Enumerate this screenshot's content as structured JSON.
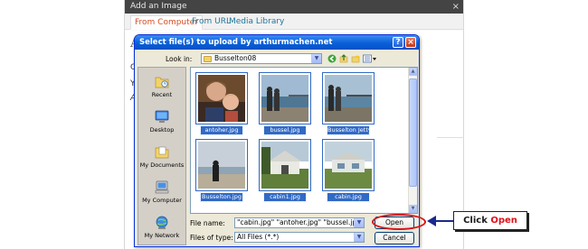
{
  "wp_modal": {
    "title": "Add an Image",
    "close_glyph": "×",
    "tabs": [
      {
        "label": "From Computer",
        "active": true
      },
      {
        "label": "From URL",
        "active": false
      },
      {
        "label": "Media Library",
        "active": false
      }
    ],
    "peek_texts": [
      "A",
      "Cl",
      "Yo",
      "Al"
    ]
  },
  "dialog": {
    "title": "Select file(s) to upload by arthurmachen.net",
    "help_glyph": "?",
    "close_glyph": "×",
    "look_in_label": "Look in:",
    "look_in_value": "Busselton08",
    "toolbar_icons": [
      "back-icon",
      "up-folder-icon",
      "new-folder-icon",
      "views-menu-icon"
    ],
    "places": [
      {
        "label": "Recent",
        "icon": "recent-icon"
      },
      {
        "label": "Desktop",
        "icon": "desktop-icon"
      },
      {
        "label": "My Documents",
        "icon": "my-documents-icon"
      },
      {
        "label": "My Computer",
        "icon": "my-computer-icon"
      },
      {
        "label": "My Network",
        "icon": "my-network-icon"
      }
    ],
    "files": [
      {
        "name": "antoher.jpg",
        "selected": true
      },
      {
        "name": "bussel.jpg",
        "selected": true
      },
      {
        "name": "Busselton Jetty.jpg",
        "selected": true
      },
      {
        "name": "Busselton.jpg",
        "selected": true
      },
      {
        "name": "cabin1.jpg",
        "selected": true
      },
      {
        "name": "cabin.jpg",
        "selected": true
      }
    ],
    "file_name_label": "File name:",
    "file_name_value": "\"cabin.jpg\" \"antoher.jpg\" \"bussel.jpg\" \"Bussel",
    "file_type_label": "Files of type:",
    "file_type_value": "All Files (*.*)",
    "open_label": "Open",
    "cancel_label": "Cancel"
  },
  "annotation": {
    "prefix": "Click ",
    "highlight": "Open",
    "ring_color": "#d7141a",
    "arrow_color": "#1a2a8c"
  },
  "colors": {
    "xp_title_blue": "#0a5fd8",
    "selection_blue": "#316ac5",
    "dialog_face": "#ece9d8",
    "wp_active_tab": "#d54e21"
  }
}
